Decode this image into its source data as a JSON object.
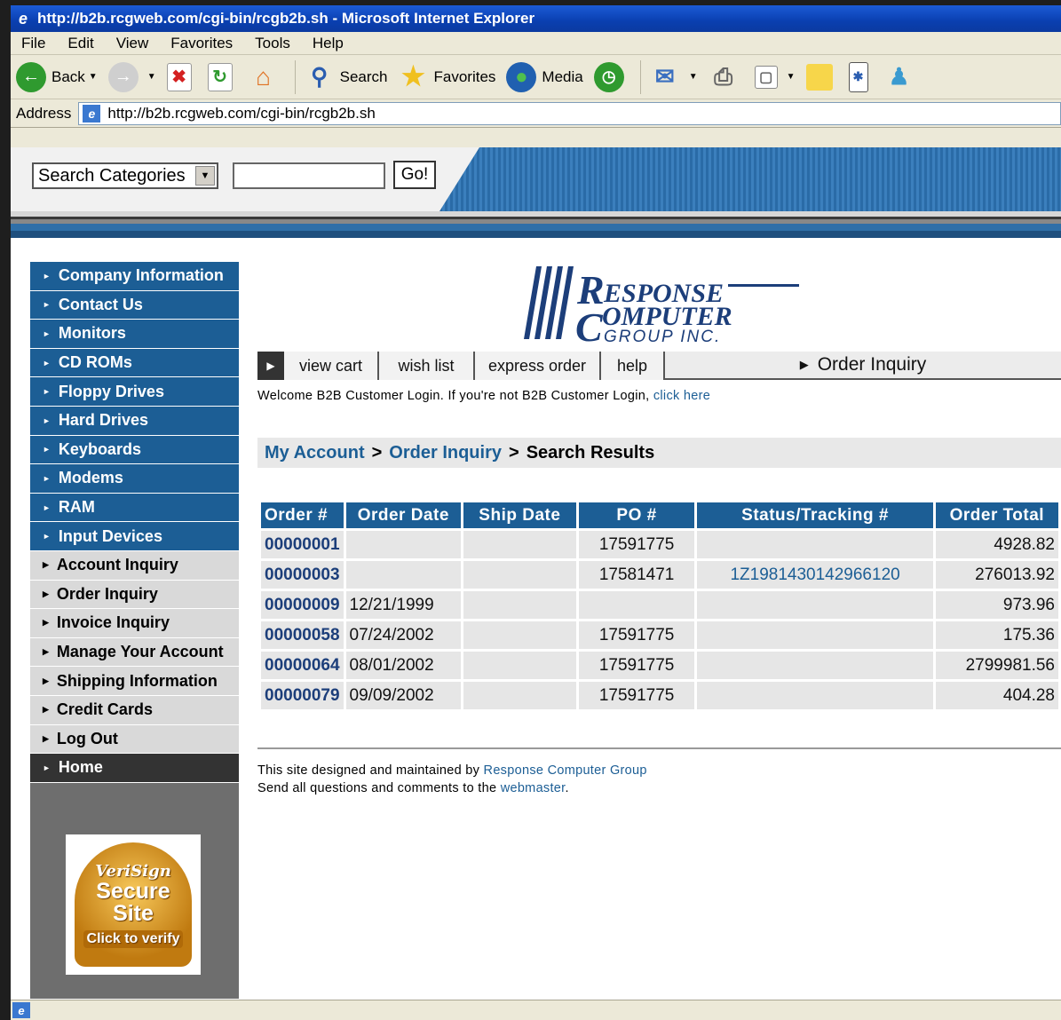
{
  "window": {
    "title": "http://b2b.rcgweb.com/cgi-bin/rcgb2b.sh - Microsoft Internet Explorer"
  },
  "menu": [
    "File",
    "Edit",
    "View",
    "Favorites",
    "Tools",
    "Help"
  ],
  "toolbar": {
    "back": "Back",
    "search": "Search",
    "favorites": "Favorites",
    "media": "Media"
  },
  "address": {
    "label": "Address",
    "url": "http://b2b.rcgweb.com/cgi-bin/rcgb2b.sh"
  },
  "site_search": {
    "category": "Search Categories",
    "query": "",
    "go": "Go!"
  },
  "logo": {
    "line1": "ESPONSE",
    "line2": "OMPUTER",
    "line3": "GROUP INC.",
    "initial1": "R",
    "initial2": "C"
  },
  "sidebar": {
    "items": [
      "Company Information",
      "Contact Us",
      "Monitors",
      "CD ROMs",
      "Floppy Drives",
      "Hard Drives",
      "Keyboards",
      "Modems",
      "RAM",
      "Input Devices",
      "Account Inquiry",
      "Order Inquiry",
      "Invoice Inquiry",
      "Manage Your Account",
      "Shipping Information",
      "Credit Cards",
      "Log Out",
      "Home"
    ],
    "verisign": {
      "brand": "VeriSign",
      "line1": "Secure",
      "line2": "Site",
      "click": "Click to verify"
    }
  },
  "tabs": {
    "view_cart": "view cart",
    "wish_list": "wish list",
    "express_order": "express order",
    "help": "help",
    "current": "Order Inquiry"
  },
  "welcome": {
    "text": "Welcome B2B Customer Login. If you're not B2B Customer Login,",
    "link": "click here"
  },
  "breadcrumb": {
    "my_account": "My Account",
    "order_inquiry": "Order Inquiry",
    "current": "Search Results",
    "sep": ">"
  },
  "orders": {
    "headers": [
      "Order #",
      "Order Date",
      "Ship Date",
      "PO #",
      "Status/Tracking #",
      "Order Total"
    ],
    "rows": [
      [
        "00000001",
        "",
        "",
        "17591775",
        "",
        "4928.82"
      ],
      [
        "00000003",
        "",
        "",
        "17581471",
        "1Z1981430142966120",
        "276013.92"
      ],
      [
        "00000009",
        "12/21/1999",
        "",
        "",
        "",
        "973.96"
      ],
      [
        "00000058",
        "07/24/2002",
        "",
        "17591775",
        "",
        "175.36"
      ],
      [
        "00000064",
        "08/01/2002",
        "",
        "17591775",
        "",
        "2799981.56"
      ],
      [
        "00000079",
        "09/09/2002",
        "",
        "17591775",
        "",
        "404.28"
      ]
    ]
  },
  "footer": {
    "line1": "This site designed and maintained by",
    "line1_link": "Response Computer Group",
    "line2": "Send all questions and comments to the",
    "line2_link": "webmaster",
    "line2_end": "."
  }
}
